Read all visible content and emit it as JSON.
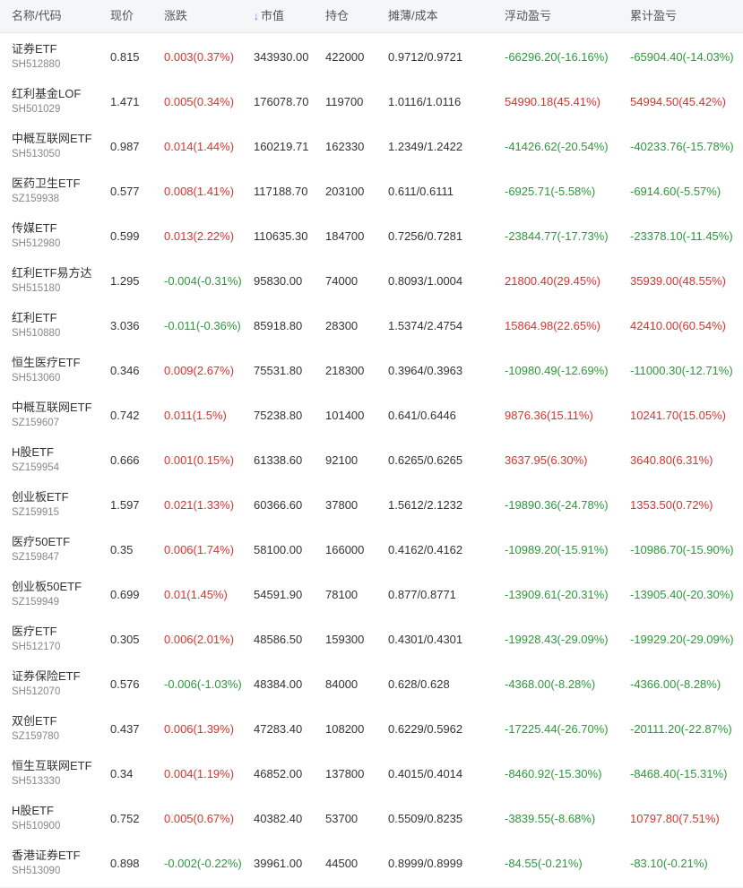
{
  "header": {
    "name_code": "名称/代码",
    "price": "现价",
    "change": "涨跌",
    "market_value_arrow": "↓",
    "market_value": "市值",
    "position": "持仓",
    "cost": "摊薄/成本",
    "float_pl": "浮动盈亏",
    "total_pl": "累计盈亏"
  },
  "colors": {
    "up": "#e0302d",
    "down": "#2a9a3a",
    "sort_arrow": "#3b7fd6"
  },
  "rows": [
    {
      "name": "证券ETF",
      "code": "SH512880",
      "price": "0.815",
      "change": "0.003(0.37%)",
      "change_dir": "up",
      "mv": "343930.00",
      "pos": "422000",
      "cost": "0.9712/0.9721",
      "fpl": "-66296.20(-16.16%)",
      "fpl_dir": "down",
      "tpl": "-65904.40(-14.03%)",
      "tpl_dir": "down"
    },
    {
      "name": "红利基金LOF",
      "code": "SH501029",
      "price": "1.471",
      "change": "0.005(0.34%)",
      "change_dir": "up",
      "mv": "176078.70",
      "pos": "119700",
      "cost": "1.0116/1.0116",
      "fpl": "54990.18(45.41%)",
      "fpl_dir": "up",
      "tpl": "54994.50(45.42%)",
      "tpl_dir": "up"
    },
    {
      "name": "中概互联网ETF",
      "code": "SH513050",
      "price": "0.987",
      "change": "0.014(1.44%)",
      "change_dir": "up",
      "mv": "160219.71",
      "pos": "162330",
      "cost": "1.2349/1.2422",
      "fpl": "-41426.62(-20.54%)",
      "fpl_dir": "down",
      "tpl": "-40233.76(-15.78%)",
      "tpl_dir": "down"
    },
    {
      "name": "医药卫生ETF",
      "code": "SZ159938",
      "price": "0.577",
      "change": "0.008(1.41%)",
      "change_dir": "up",
      "mv": "117188.70",
      "pos": "203100",
      "cost": "0.611/0.6111",
      "fpl": "-6925.71(-5.58%)",
      "fpl_dir": "down",
      "tpl": "-6914.60(-5.57%)",
      "tpl_dir": "down"
    },
    {
      "name": "传媒ETF",
      "code": "SH512980",
      "price": "0.599",
      "change": "0.013(2.22%)",
      "change_dir": "up",
      "mv": "110635.30",
      "pos": "184700",
      "cost": "0.7256/0.7281",
      "fpl": "-23844.77(-17.73%)",
      "fpl_dir": "down",
      "tpl": "-23378.10(-11.45%)",
      "tpl_dir": "down"
    },
    {
      "name": "红利ETF易方达",
      "code": "SH515180",
      "price": "1.295",
      "change": "-0.004(-0.31%)",
      "change_dir": "down",
      "mv": "95830.00",
      "pos": "74000",
      "cost": "0.8093/1.0004",
      "fpl": "21800.40(29.45%)",
      "fpl_dir": "up",
      "tpl": "35939.00(48.55%)",
      "tpl_dir": "up"
    },
    {
      "name": "红利ETF",
      "code": "SH510880",
      "price": "3.036",
      "change": "-0.011(-0.36%)",
      "change_dir": "down",
      "mv": "85918.80",
      "pos": "28300",
      "cost": "1.5374/2.4754",
      "fpl": "15864.98(22.65%)",
      "fpl_dir": "up",
      "tpl": "42410.00(60.54%)",
      "tpl_dir": "up"
    },
    {
      "name": "恒生医疗ETF",
      "code": "SH513060",
      "price": "0.346",
      "change": "0.009(2.67%)",
      "change_dir": "up",
      "mv": "75531.80",
      "pos": "218300",
      "cost": "0.3964/0.3963",
      "fpl": "-10980.49(-12.69%)",
      "fpl_dir": "down",
      "tpl": "-11000.30(-12.71%)",
      "tpl_dir": "down"
    },
    {
      "name": "中概互联网ETF",
      "code": "SZ159607",
      "price": "0.742",
      "change": "0.011(1.5%)",
      "change_dir": "up",
      "mv": "75238.80",
      "pos": "101400",
      "cost": "0.641/0.6446",
      "fpl": "9876.36(15.11%)",
      "fpl_dir": "up",
      "tpl": "10241.70(15.05%)",
      "tpl_dir": "up"
    },
    {
      "name": "H股ETF",
      "code": "SZ159954",
      "price": "0.666",
      "change": "0.001(0.15%)",
      "change_dir": "up",
      "mv": "61338.60",
      "pos": "92100",
      "cost": "0.6265/0.6265",
      "fpl": "3637.95(6.30%)",
      "fpl_dir": "up",
      "tpl": "3640.80(6.31%)",
      "tpl_dir": "up"
    },
    {
      "name": "创业板ETF",
      "code": "SZ159915",
      "price": "1.597",
      "change": "0.021(1.33%)",
      "change_dir": "up",
      "mv": "60366.60",
      "pos": "37800",
      "cost": "1.5612/2.1232",
      "fpl": "-19890.36(-24.78%)",
      "fpl_dir": "down",
      "tpl": "1353.50(0.72%)",
      "tpl_dir": "up"
    },
    {
      "name": "医疗50ETF",
      "code": "SZ159847",
      "price": "0.35",
      "change": "0.006(1.74%)",
      "change_dir": "up",
      "mv": "58100.00",
      "pos": "166000",
      "cost": "0.4162/0.4162",
      "fpl": "-10989.20(-15.91%)",
      "fpl_dir": "down",
      "tpl": "-10986.70(-15.90%)",
      "tpl_dir": "down"
    },
    {
      "name": "创业板50ETF",
      "code": "SZ159949",
      "price": "0.699",
      "change": "0.01(1.45%)",
      "change_dir": "up",
      "mv": "54591.90",
      "pos": "78100",
      "cost": "0.877/0.8771",
      "fpl": "-13909.61(-20.31%)",
      "fpl_dir": "down",
      "tpl": "-13905.40(-20.30%)",
      "tpl_dir": "down"
    },
    {
      "name": "医疗ETF",
      "code": "SH512170",
      "price": "0.305",
      "change": "0.006(2.01%)",
      "change_dir": "up",
      "mv": "48586.50",
      "pos": "159300",
      "cost": "0.4301/0.4301",
      "fpl": "-19928.43(-29.09%)",
      "fpl_dir": "down",
      "tpl": "-19929.20(-29.09%)",
      "tpl_dir": "down"
    },
    {
      "name": "证券保险ETF",
      "code": "SH512070",
      "price": "0.576",
      "change": "-0.006(-1.03%)",
      "change_dir": "down",
      "mv": "48384.00",
      "pos": "84000",
      "cost": "0.628/0.628",
      "fpl": "-4368.00(-8.28%)",
      "fpl_dir": "down",
      "tpl": "-4366.00(-8.28%)",
      "tpl_dir": "down"
    },
    {
      "name": "双创ETF",
      "code": "SZ159780",
      "price": "0.437",
      "change": "0.006(1.39%)",
      "change_dir": "up",
      "mv": "47283.40",
      "pos": "108200",
      "cost": "0.6229/0.5962",
      "fpl": "-17225.44(-26.70%)",
      "fpl_dir": "down",
      "tpl": "-20111.20(-22.87%)",
      "tpl_dir": "down"
    },
    {
      "name": "恒生互联网ETF",
      "code": "SH513330",
      "price": "0.34",
      "change": "0.004(1.19%)",
      "change_dir": "up",
      "mv": "46852.00",
      "pos": "137800",
      "cost": "0.4015/0.4014",
      "fpl": "-8460.92(-15.30%)",
      "fpl_dir": "down",
      "tpl": "-8468.40(-15.31%)",
      "tpl_dir": "down"
    },
    {
      "name": "H股ETF",
      "code": "SH510900",
      "price": "0.752",
      "change": "0.005(0.67%)",
      "change_dir": "up",
      "mv": "40382.40",
      "pos": "53700",
      "cost": "0.5509/0.8235",
      "fpl": "-3839.55(-8.68%)",
      "fpl_dir": "down",
      "tpl": "10797.80(7.51%)",
      "tpl_dir": "up"
    },
    {
      "name": "香港证券ETF",
      "code": "SH513090",
      "price": "0.898",
      "change": "-0.002(-0.22%)",
      "change_dir": "down",
      "mv": "39961.00",
      "pos": "44500",
      "cost": "0.8999/0.8999",
      "fpl": "-84.55(-0.21%)",
      "fpl_dir": "down",
      "tpl": "-83.10(-0.21%)",
      "tpl_dir": "down"
    }
  ]
}
